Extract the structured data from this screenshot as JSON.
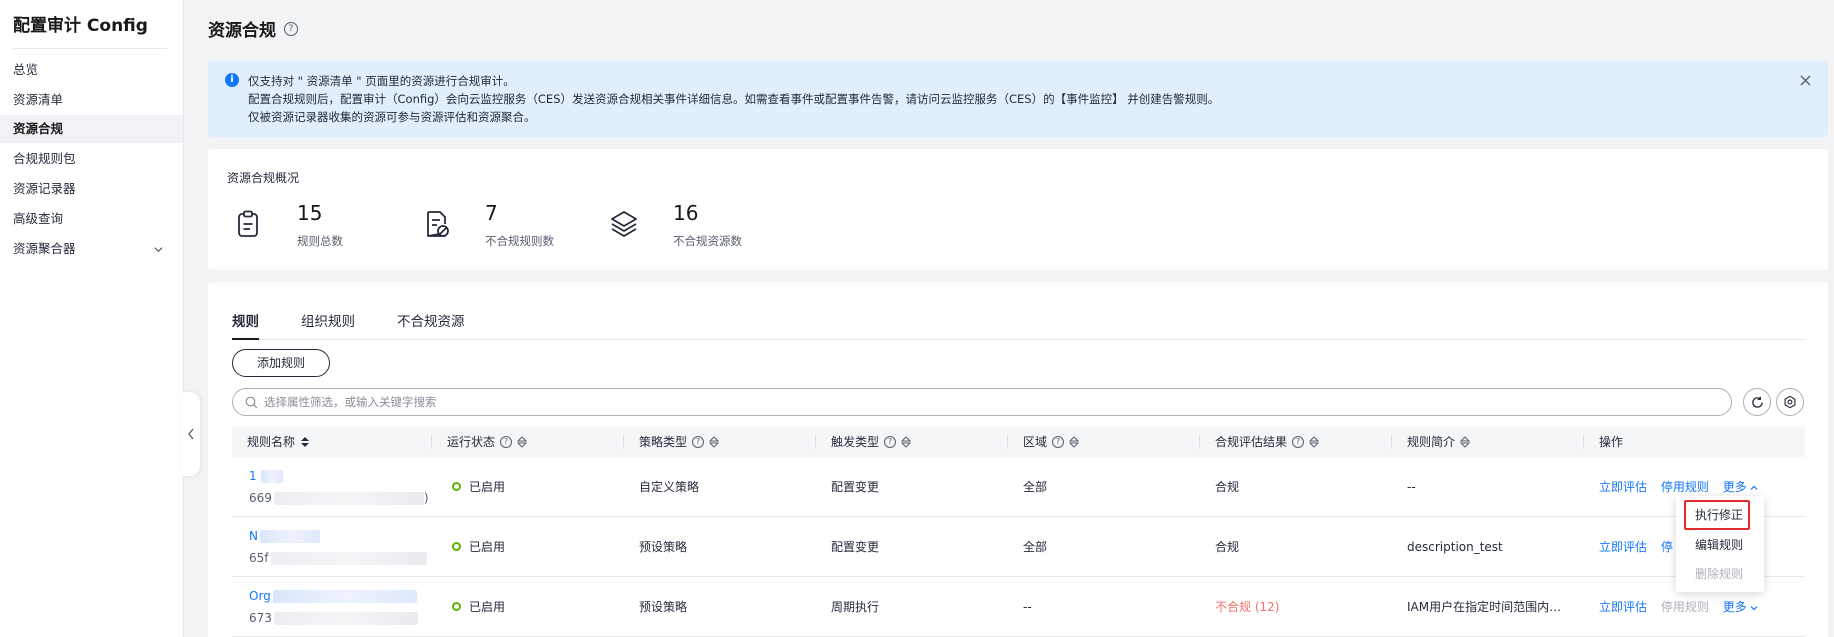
{
  "sidebar": {
    "brand": "配置审计 Config",
    "items": [
      {
        "label": "总览"
      },
      {
        "label": "资源清单"
      },
      {
        "label": "资源合规"
      },
      {
        "label": "合规规则包"
      },
      {
        "label": "资源记录器"
      },
      {
        "label": "高级查询"
      },
      {
        "label": "资源聚合器"
      }
    ],
    "active_index": 2
  },
  "page": {
    "title": "资源合规",
    "help": "?"
  },
  "notice": {
    "line1": "仅支持对 \" 资源清单 \" 页面里的资源进行合规审计。",
    "line2": "配置合规规则后，配置审计（Config）会向云监控服务（CES）发送资源合规相关事件详细信息。如需查看事件或配置事件告警，请访问云监控服务（CES）的【事件监控】 并创建告警规则。",
    "line3": "仅被资源记录器收集的资源可参与资源评估和资源聚合。"
  },
  "overview": {
    "title": "资源合规概况",
    "stats": [
      {
        "value": "15",
        "label": "规则总数",
        "icon": "clipboard-icon"
      },
      {
        "value": "7",
        "label": "不合规规则数",
        "icon": "document-blocked-icon"
      },
      {
        "value": "16",
        "label": "不合规资源数",
        "icon": "layers-icon"
      }
    ]
  },
  "tabs": [
    {
      "label": "规则"
    },
    {
      "label": "组织规则"
    },
    {
      "label": "不合规资源"
    }
  ],
  "active_tab": 0,
  "toolbar": {
    "add_label": "添加规则",
    "search_placeholder": "选择属性筛选，或输入关键字搜索"
  },
  "table": {
    "columns": [
      "规则名称",
      "运行状态",
      "策略类型",
      "触发类型",
      "区域",
      "合规评估结果",
      "规则简介",
      "操作"
    ],
    "rows": [
      {
        "name": "1",
        "id": "669",
        "id_suffix": ")",
        "status": "已启用",
        "policy": "自定义策略",
        "trigger": "配置变更",
        "region": "全部",
        "result": "合规",
        "result_bad": false,
        "desc": "--",
        "actions": [
          "立即评估",
          "停用规则",
          "更多"
        ]
      },
      {
        "name": "N",
        "id": "65f",
        "id_suffix": "",
        "status": "已启用",
        "policy": "预设策略",
        "trigger": "配置变更",
        "region": "全部",
        "result": "合规",
        "result_bad": false,
        "desc": "description_test",
        "actions": [
          "立即评估",
          "停",
          "更多"
        ]
      },
      {
        "name": "Org",
        "id": "673",
        "id_suffix": "",
        "status": "已启用",
        "policy": "预设策略",
        "trigger": "周期执行",
        "region": "--",
        "result": "不合规 (12)",
        "result_bad": true,
        "desc": "IAM用户在指定时间范围内…",
        "actions": [
          "立即评估",
          "停用规则",
          "更多"
        ]
      }
    ]
  },
  "dropdown": {
    "items": [
      {
        "label": "执行修正",
        "disabled": false
      },
      {
        "label": "编辑规则",
        "disabled": false
      },
      {
        "label": "删除规则",
        "disabled": true
      }
    ]
  },
  "colors": {
    "accent": "#1476ff",
    "success": "#5cb300",
    "danger": "#f66f6a",
    "highlight": "#e22a2a"
  }
}
